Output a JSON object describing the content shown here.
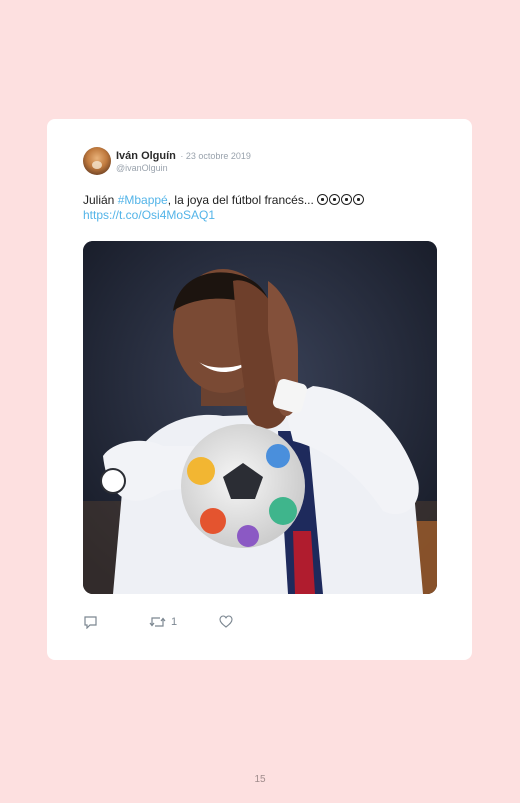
{
  "tweet": {
    "author_name": "Iván Olguín",
    "date": "· 23 octobre 2019",
    "handle": "@ivanOlguin",
    "text_prefix": "Julián ",
    "hashtag": "#Mbappé",
    "text_suffix": ", la joya del fútbol francés...",
    "emojis": [
      "soccer-ball",
      "soccer-ball",
      "soccer-ball",
      "soccer-ball"
    ],
    "link": "https://t.co/Osi4MoSAQ1",
    "retweet_count": "1",
    "link_color": "#53b4e8"
  },
  "photo": {
    "subject": "smiling football player in white kit clapping hands, holding a colorful match ball"
  },
  "page_number": "15"
}
